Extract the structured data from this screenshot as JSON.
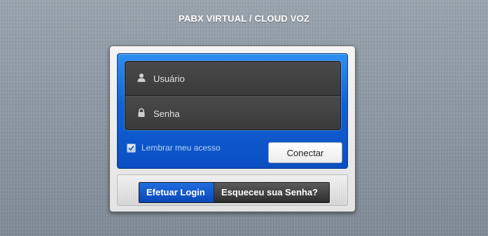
{
  "page": {
    "title": "PABX VIRTUAL / CLOUD VOZ"
  },
  "login_form": {
    "username": {
      "placeholder": "Usuário",
      "value": "",
      "icon": "user-icon"
    },
    "password": {
      "placeholder": "Senha",
      "value": "",
      "icon": "lock-icon"
    },
    "remember": {
      "label": "Lembrar meu acesso",
      "checked": true
    },
    "submit_label": "Conectar"
  },
  "tabs": [
    {
      "label": "Efetuar Login",
      "active": true
    },
    {
      "label": "Esqueceu sua Senha?",
      "active": false
    }
  ],
  "colors": {
    "accent_blue": "#1161d6",
    "field_dark": "#3b3b3b",
    "tab_active": "#0b47b8",
    "tab_inactive": "#2e2e2e"
  }
}
